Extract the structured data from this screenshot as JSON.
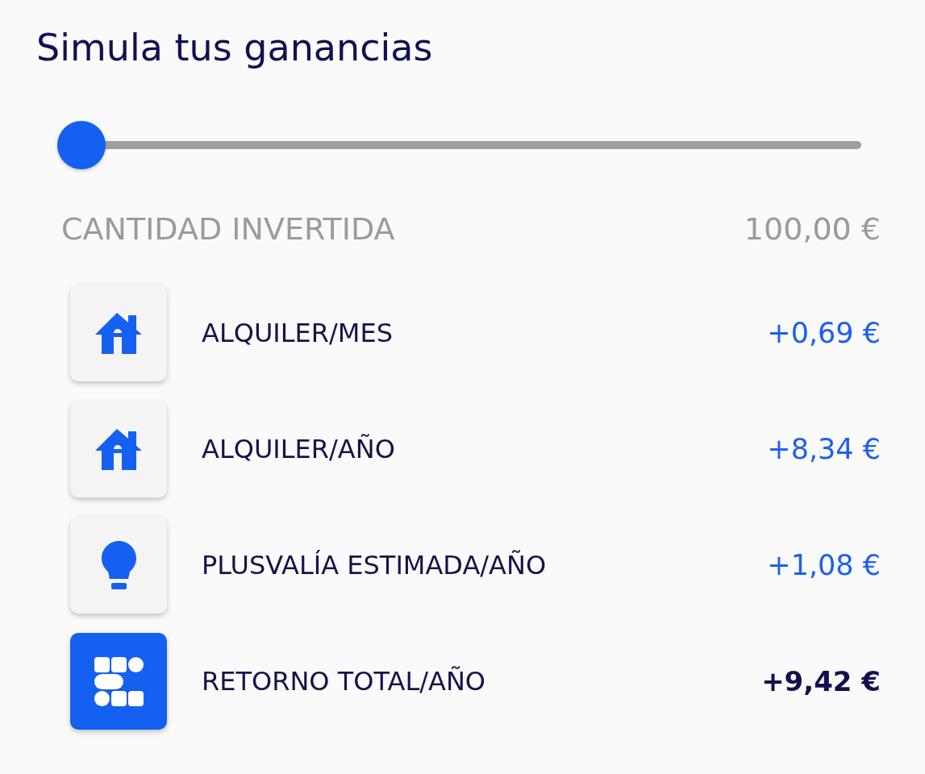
{
  "title": "Simula tus ganancias",
  "slider": {
    "level": 0
  },
  "invested": {
    "label": "CANTIDAD INVERTIDA",
    "value": "100,00 €"
  },
  "returns": [
    {
      "kind": "rent",
      "label": "ALQUILER/MES",
      "value": "+0,69 €"
    },
    {
      "kind": "rent",
      "label": "ALQUILER/AÑO",
      "value": "+8,34 €"
    },
    {
      "kind": "appreciation",
      "label": "PLUSVALÍA ESTIMADA/AÑO",
      "value": "+1,08 €"
    },
    {
      "kind": "total",
      "label": "RETORNO TOTAL/AÑO",
      "value": "+9,42 €"
    }
  ]
}
